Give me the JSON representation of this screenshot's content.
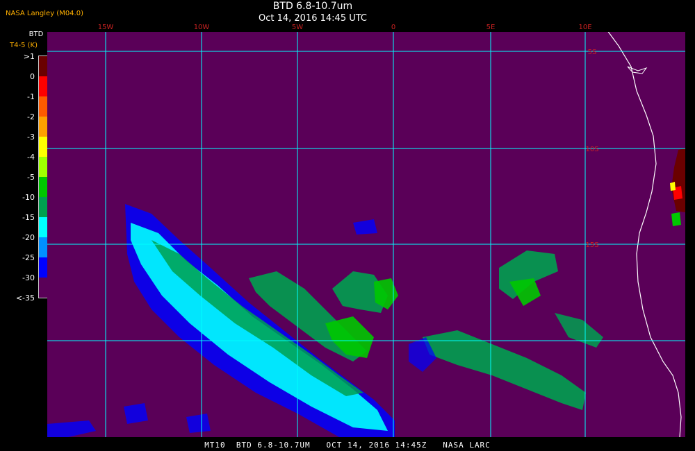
{
  "header": {
    "credit": "NASA Langley (M04.0)",
    "title": "BTD 6.8-10.7um",
    "subtitle": "Oct 14, 2016 14:45 UTC"
  },
  "legend": {
    "title": "BTD",
    "subtitle": "T4-5 (K)",
    "ticks": [
      ">1",
      "0",
      "-1",
      "-2",
      "-3",
      "-4",
      "-5",
      "-10",
      "-15",
      "-20",
      "-25",
      "-30",
      "<-35"
    ],
    "colors": [
      "#6a0000",
      "#ff0000",
      "#ff5a00",
      "#ffa000",
      "#ffff00",
      "#a0ff00",
      "#00c800",
      "#00a050",
      "#00ffff",
      "#0090ff",
      "#0000ff",
      "#5a0058"
    ]
  },
  "map": {
    "background_color": "#5a0058",
    "grid_color": "#00ffff",
    "lon_labels": [
      "15W",
      "10W",
      "5W",
      "0",
      "5E",
      "10E"
    ],
    "lat_labels": [
      "5S",
      "10S",
      "15S"
    ]
  },
  "footer": {
    "text": "MT10  BTD 6.8-10.7UM   OCT 14, 2016 14:45Z   NASA LARC"
  }
}
